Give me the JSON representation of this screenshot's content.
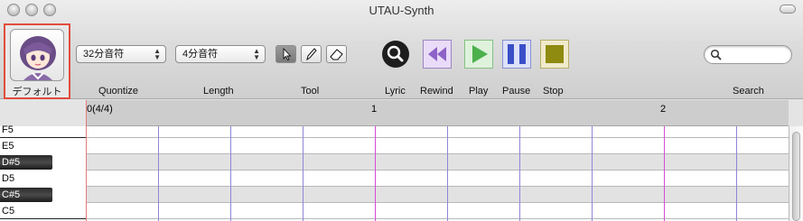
{
  "window": {
    "title": "UTAU-Synth"
  },
  "singer": {
    "name": "デフォルト"
  },
  "toolbar": {
    "quantize": {
      "value": "32分音符",
      "label": "Quontize"
    },
    "length": {
      "value": "4分音符",
      "label": "Length"
    },
    "tool_label": "Tool",
    "lyric_label": "Lyric",
    "rewind_label": "Rewind",
    "play_label": "Play",
    "pause_label": "Pause",
    "stop_label": "Stop",
    "search_label": "Search",
    "search_placeholder": ""
  },
  "colors": {
    "highlight": "#e24c3c",
    "rewind": "#8d62c8",
    "play": "#4cb14c",
    "pause": "#3a4fc8",
    "stop": "#8f8a10",
    "measure_line": "#d64bd6",
    "beat_line": "#8d86d8"
  },
  "ruler": {
    "start": "0(4/4)",
    "marks": [
      "1",
      "2"
    ]
  },
  "keys": [
    {
      "note": "F5",
      "black": false
    },
    {
      "note": "E5",
      "black": false
    },
    {
      "note": "D#5",
      "black": true
    },
    {
      "note": "D5",
      "black": false
    },
    {
      "note": "C#5",
      "black": true
    },
    {
      "note": "C5",
      "black": false
    }
  ]
}
